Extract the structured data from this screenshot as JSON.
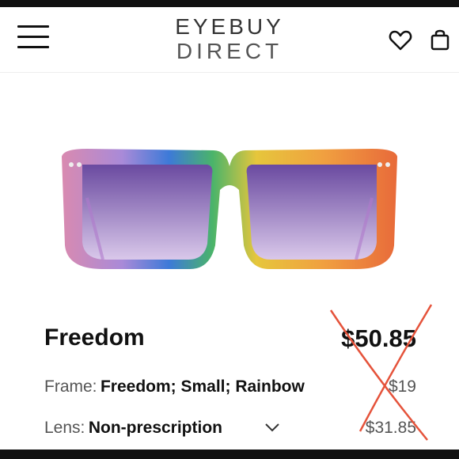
{
  "header": {
    "logo_line1": "EYEBUY",
    "logo_line2": "DIRECT",
    "menu_icon": "hamburger-menu-icon",
    "wishlist_icon": "heart-icon",
    "cart_icon": "shopping-bag-icon"
  },
  "product": {
    "name": "Freedom",
    "price": "$50.85",
    "frame_label": "Frame:",
    "frame_value": "Freedom; Small; Rainbow",
    "frame_price": "$19",
    "lens_label": "Lens:",
    "lens_value": "Non-prescription",
    "lens_price": "$31.85"
  },
  "colors": {
    "accent_cross": "#e5533b",
    "lens_tint": "#7a5aa8"
  }
}
